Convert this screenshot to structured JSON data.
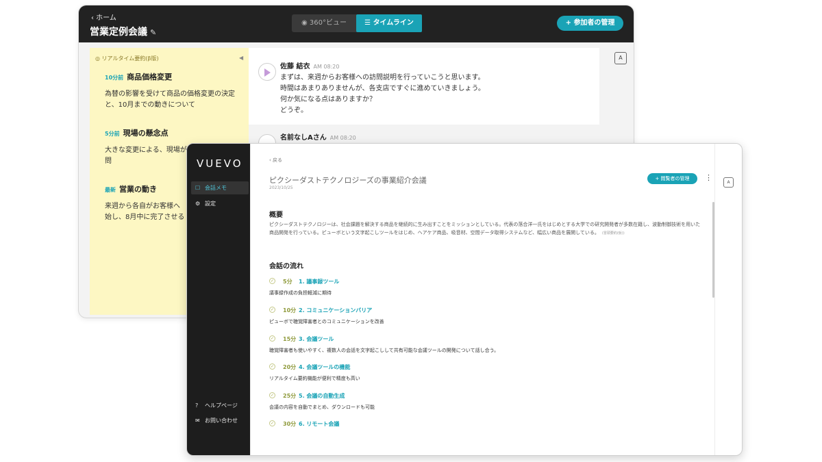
{
  "back_window": {
    "home_label": "‹ ホーム",
    "title": "営業定例会議",
    "tabs": [
      {
        "label": "360°ビュー",
        "active": false
      },
      {
        "label": "タイムライン",
        "active": true
      }
    ],
    "manage_button": "参加者の管理",
    "summary": {
      "heading": "リアルタイム要約(β版)",
      "items": [
        {
          "time": "10分前",
          "title": "商品価格変更",
          "body": "為替の影響を受けて商品の価格変更の決定と、10月までの動きについて"
        },
        {
          "time": "5分前",
          "title": "現場の懸念点",
          "body": "大きな変更による、現場が\n問"
        },
        {
          "time": "最新",
          "title": "営業の動き",
          "body": "来週から各自がお客様へ\n始し、8月中に完了させる"
        }
      ]
    },
    "messages": [
      {
        "name": "佐藤 結衣",
        "time": "AM 08:20",
        "lines": [
          "まずは、来週からお客様への訪問説明を行っていこうと思います。",
          "時間はあまりありませんが、各支店ですぐに進めていきましょう。",
          "何か気になる点はありますか？",
          "どうぞ。"
        ]
      },
      {
        "name": "名前なしAさん",
        "time": "AM 08:20",
        "lines": []
      }
    ],
    "side_icon": "A"
  },
  "front_window": {
    "logo": "VUEVO",
    "nav": [
      {
        "label": "会話メモ",
        "icon": "memo-icon",
        "active": true
      },
      {
        "label": "設定",
        "icon": "gear-icon",
        "active": false
      }
    ],
    "footer_nav": [
      {
        "label": "ヘルプページ",
        "icon": "help-icon"
      },
      {
        "label": "お問い合わせ",
        "icon": "mail-icon"
      }
    ],
    "back_label": "‹ 戻る",
    "title": "ピクシーダストテクノロジーズの事業紹介会議",
    "date": "2023/10/25",
    "manage_button": "閲覧者の管理",
    "overview_heading": "概要",
    "overview_text": "ピクシーダストテクノロジーは、社会課題を解決する商品を継続的に生み出すことをミッションとしている。代表の落合洋一氏をはじめとする大学での研究開発者が多数在籍し、波動制御技術を用いた商品開発を行っている。ピューボという文字起こしツールをはじめ、ヘアケア商品、吸音材、空間データ取得システムなど、幅広い商品を展開している。",
    "overview_note": "(冒頭要約(仮))",
    "flow_heading": "会話の流れ",
    "flow": [
      {
        "min": "5分",
        "topic": "1. 議事録ツール",
        "desc": "議事録作成の負担軽減に期待"
      },
      {
        "min": "10分",
        "topic": "2. コミュニケーションバリア",
        "desc": "ピューボで聴覚障害者とのコミュニケーションを改善"
      },
      {
        "min": "15分",
        "topic": "3. 会議ツール",
        "desc": "聴覚障害者も使いやすく、複数人の会話を文字起こしして共有可能な会議ツールの開発について話し合う。"
      },
      {
        "min": "20分",
        "topic": "4. 会議ツールの機能",
        "desc": "リアルタイム要約機能が便利で精度も高い"
      },
      {
        "min": "25分",
        "topic": "5. 会議の自動生成",
        "desc": "会議の内容を自動でまとめ、ダウンロードも可能"
      },
      {
        "min": "30分",
        "topic": "6. リモート会議",
        "desc": ""
      }
    ],
    "side_icon": "A"
  },
  "colors": {
    "accent": "#1aa3b6",
    "header_dark": "#222222",
    "sidebar_dark": "#1d1d1d",
    "summary_yellow": "#fdf7c3",
    "flow_olive": "#8f9a3c"
  }
}
